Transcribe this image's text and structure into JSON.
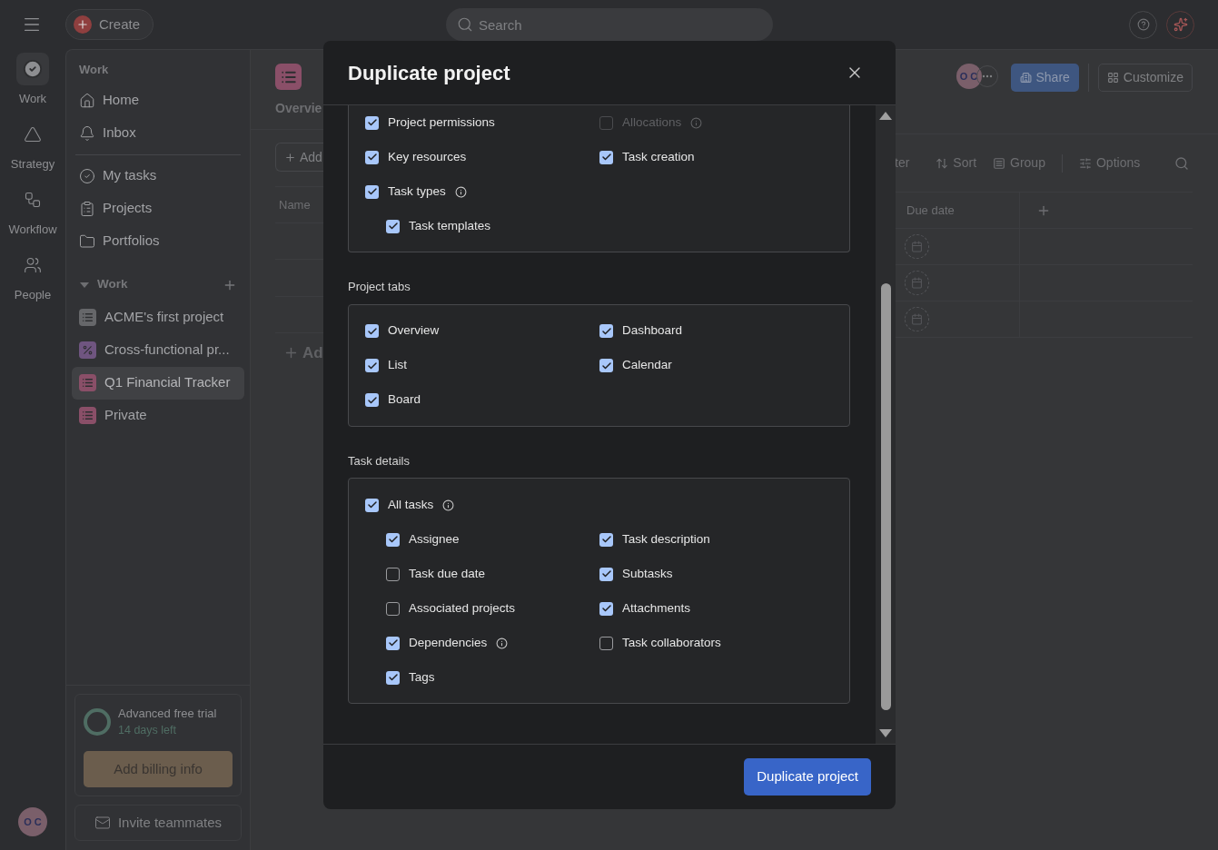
{
  "top_bar": {
    "create_button": "Create",
    "search_placeholder": "Search"
  },
  "rail": [
    {
      "label": "Work",
      "kind": "check",
      "selected": true
    },
    {
      "label": "Strategy",
      "kind": "triangle",
      "selected": false
    },
    {
      "label": "Workflow",
      "kind": "workflow",
      "selected": false
    },
    {
      "label": "People",
      "kind": "people",
      "selected": false
    }
  ],
  "user_avatar": "O C",
  "sidebar": {
    "heading": "Work",
    "items": [
      {
        "label": "Home",
        "kind": "home"
      },
      {
        "label": "Inbox",
        "kind": "bell"
      }
    ],
    "items_2": [
      {
        "label": "My tasks",
        "kind": "check"
      },
      {
        "label": "Projects",
        "kind": "clipboard"
      },
      {
        "label": "Portfolios",
        "kind": "folder"
      }
    ],
    "section": {
      "label": "Work",
      "expanded": true
    },
    "projects": [
      {
        "label": "ACME's first project",
        "kind": "list",
        "color": "#66676a",
        "selected": false
      },
      {
        "label": "Cross-functional pr...",
        "kind": "percent",
        "color": "#6f5580",
        "selected": false
      },
      {
        "label": "Q1 Financial Tracker",
        "kind": "list",
        "color": "#8a4f68",
        "selected": true
      },
      {
        "label": "Private",
        "kind": "list",
        "color": "#8a4f68",
        "selected": false
      }
    ],
    "trial": {
      "title": "Advanced free trial",
      "subtitle": "14 days left",
      "button": "Add billing info"
    },
    "invite_button": "Invite teammates"
  },
  "project": {
    "tab": "Overvie",
    "add_button": "Add",
    "name_column": "Name",
    "add_row_button": "Ad",
    "members_avatar": "O C",
    "share_button": "Share",
    "customize_button": "Customize",
    "toolbar_cut_label": "ter",
    "toolbar": [
      {
        "label": "Sort",
        "kind": "sort"
      },
      {
        "label": "Group",
        "kind": "group"
      },
      {
        "label": "Options",
        "kind": "options"
      }
    ],
    "due_date_column": "Due date"
  },
  "dialog": {
    "title": "Duplicate project",
    "action_button": "Duplicate project",
    "sections": [
      {
        "options": [
          {
            "label": "Project permissions",
            "checked": true,
            "disabled": false,
            "info": false
          },
          {
            "label": "Allocations",
            "checked": false,
            "disabled": true,
            "info": true
          },
          {
            "label": "Key resources",
            "checked": true,
            "disabled": false,
            "info": false
          },
          {
            "label": "Task creation",
            "checked": true,
            "disabled": false,
            "info": false
          },
          {
            "label": "Task types",
            "checked": true,
            "disabled": false,
            "info": true,
            "children": [
              {
                "label": "Task templates",
                "checked": true,
                "disabled": false,
                "info": false
              }
            ]
          }
        ]
      },
      {
        "heading": "Project tabs",
        "options": [
          {
            "label": "Overview",
            "checked": true,
            "disabled": false,
            "info": false
          },
          {
            "label": "Dashboard",
            "checked": true,
            "disabled": false,
            "info": false
          },
          {
            "label": "List",
            "checked": true,
            "disabled": false,
            "info": false
          },
          {
            "label": "Calendar",
            "checked": true,
            "disabled": false,
            "info": false
          },
          {
            "label": "Board",
            "checked": true,
            "disabled": false,
            "info": false
          }
        ]
      },
      {
        "heading": "Task details",
        "options": [
          {
            "label": "All tasks",
            "checked": true,
            "disabled": false,
            "info": true,
            "children": [
              {
                "label": "Assignee",
                "checked": true,
                "disabled": false,
                "info": false
              },
              {
                "label": "Task description",
                "checked": true,
                "disabled": false,
                "info": false
              },
              {
                "label": "Task due date",
                "checked": false,
                "disabled": false,
                "info": false
              },
              {
                "label": "Subtasks",
                "checked": true,
                "disabled": false,
                "info": false
              },
              {
                "label": "Associated projects",
                "checked": false,
                "disabled": false,
                "info": false
              },
              {
                "label": "Attachments",
                "checked": true,
                "disabled": false,
                "info": false
              },
              {
                "label": "Dependencies",
                "checked": true,
                "disabled": false,
                "info": true
              },
              {
                "label": "Task collaborators",
                "checked": false,
                "disabled": false,
                "info": false
              },
              {
                "label": "Tags",
                "checked": true,
                "disabled": false,
                "info": false
              }
            ]
          }
        ]
      }
    ]
  }
}
